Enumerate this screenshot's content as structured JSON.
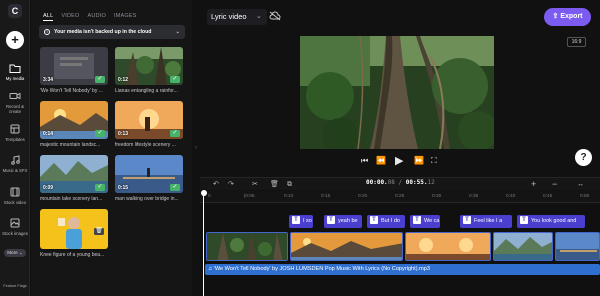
{
  "nav": {
    "logo_text": "C",
    "items": [
      {
        "label": "My media",
        "icon": "folder-icon"
      },
      {
        "label": "Record & create",
        "icon": "camera-icon"
      },
      {
        "label": "Templates",
        "icon": "templates-icon"
      },
      {
        "label": "Music & SFX",
        "icon": "music-icon"
      },
      {
        "label": "Stock video",
        "icon": "film-icon"
      },
      {
        "label": "Stock images",
        "icon": "image-icon"
      }
    ],
    "more_label": "More",
    "feature_flags": "Feature Flags"
  },
  "media": {
    "tabs": [
      "ALL",
      "VIDEO",
      "AUDIO",
      "IMAGES"
    ],
    "cloud_banner": "Your media isn't backed up in the cloud",
    "tiles": [
      {
        "duration": "3:34",
        "caption": "'We Won't Tell Nobody' by ..."
      },
      {
        "duration": "0:12",
        "caption": "Lianas entangling a rainfor..."
      },
      {
        "duration": "0:14",
        "caption": "majestic mountain landsc..."
      },
      {
        "duration": "0:13",
        "caption": "freedom lifestyle scenery ..."
      },
      {
        "duration": "0:09",
        "caption": "mountain lake scenery lan..."
      },
      {
        "duration": "0:15",
        "caption": "man walking over bridge in..."
      },
      {
        "duration": "",
        "caption": "Knee figure of a young bea..."
      }
    ]
  },
  "topbar": {
    "project_name": "Lyric video",
    "export_label": "Export",
    "aspect_ratio": "16:9"
  },
  "timeline": {
    "timecode_current": "00:00.",
    "timecode_current_frac": "08",
    "timecode_sep": " / ",
    "timecode_total": "00:55.",
    "timecode_total_frac": "12",
    "ruler_ticks": [
      "0",
      "|0:05",
      "0:10",
      "0:15",
      "0:20",
      "0:25",
      "0:30",
      "0:35",
      "0:40",
      "0:45",
      "0:50"
    ],
    "text_clips": [
      "I so",
      "yeah be",
      "But I do",
      "We ca",
      "Feel like I a",
      "You look good and"
    ],
    "audio_label": "'We Won't Tell Nobody' by JOSH LUMSDEN Pop Music With Lyrics (No Copyright).mp3"
  },
  "colors": {
    "accent": "#7c5cf0",
    "text_clip": "#4b3fd0",
    "audio": "#2f6fd0",
    "check": "#47b36a"
  }
}
